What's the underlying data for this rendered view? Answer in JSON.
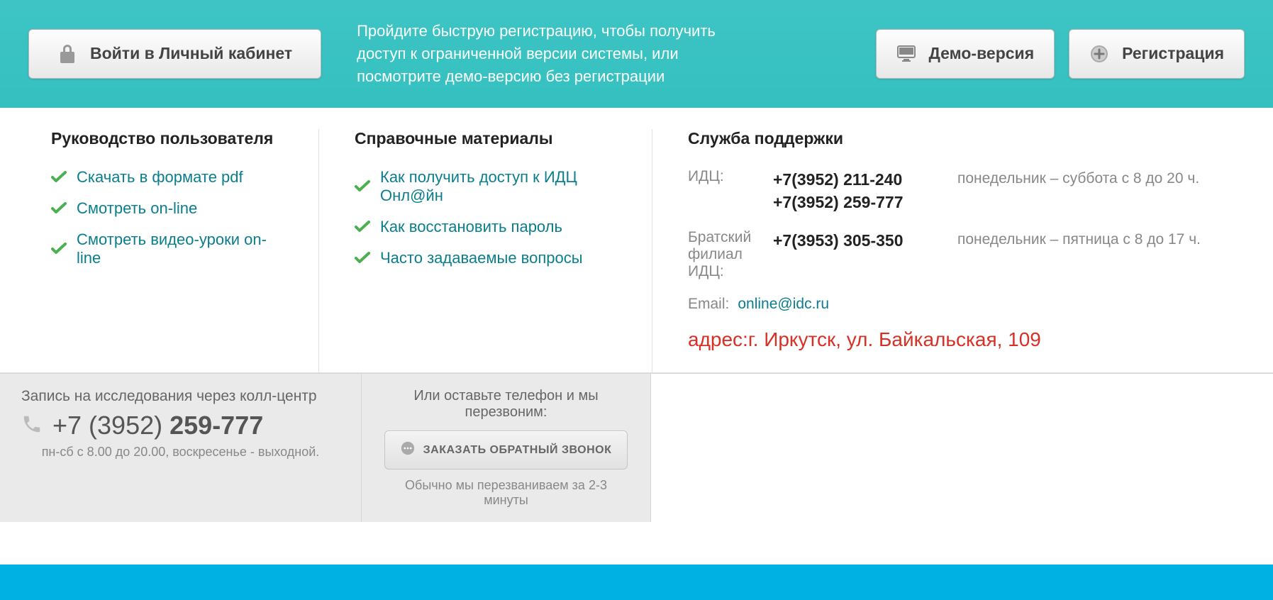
{
  "topbar": {
    "login_label": "Войти в Личный кабинет",
    "promo_text": "Пройдите быструю регистрацию, чтобы получить доступ к ограниченной версии системы, или посмотрите демо-версию без регистрации",
    "demo_label": "Демо-версия",
    "register_label": "Регистрация"
  },
  "col1": {
    "title": "Руководство пользователя",
    "links": [
      "Скачать в формате pdf",
      "Смотреть on-line",
      "Смотреть видео-уроки on-line"
    ]
  },
  "col2": {
    "title": "Справочные материалы",
    "links": [
      "Как получить доступ к ИДЦ Онл@йн",
      "Как восстановить пароль",
      "Часто задаваемые вопросы"
    ]
  },
  "col3": {
    "title": "Служба поддержки",
    "rows": [
      {
        "label": "ИДЦ:",
        "phones": [
          "+7(3952) 211-240",
          "+7(3952) 259-777"
        ],
        "hours": "понедельник – суббота с 8 до 20 ч."
      },
      {
        "label": "Братский филиал ИДЦ:",
        "phones": [
          "+7(3953) 305-350"
        ],
        "hours": "понедельник – пятница с 8 до 17 ч."
      }
    ],
    "email_label": "Email:",
    "email": "online@idc.ru",
    "address": "адрес:г. Иркутск, ул. Байкальская, 109"
  },
  "bottom_left": {
    "title": "Запись на исследования через колл-центр",
    "phone_prefix": "+7 (3952) ",
    "phone_bold": "259-777",
    "sub": "пн-сб с 8.00 до 20.00, воскресенье - выходной."
  },
  "bottom_mid": {
    "title": "Или оставьте телефон и мы перезвоним:",
    "button": "ЗАКАЗАТЬ ОБРАТНЫЙ ЗВОНОК",
    "sub": "Обычно мы перезваниваем за 2-3 минуты"
  }
}
